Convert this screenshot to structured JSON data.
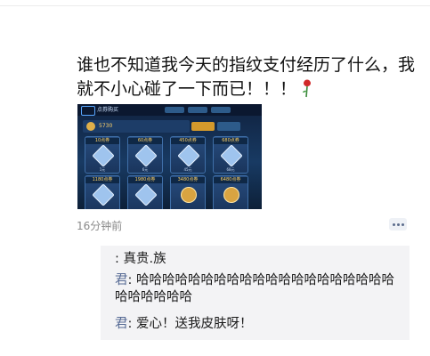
{
  "post": {
    "text": "谁也不知道我今天的指纹支付经历了什么，我就不小心碰了一下而已！！！",
    "emoji_icon": "wilted-rose-icon"
  },
  "screenshot": {
    "title": "点券购买",
    "points": "5730",
    "items": [
      {
        "price": "10点券",
        "note": "1元"
      },
      {
        "price": "60点券",
        "note": "6元"
      },
      {
        "price": "450点券",
        "note": "45元"
      },
      {
        "price": "680点券",
        "note": "68元"
      },
      {
        "price": "1180点券",
        "note": ""
      },
      {
        "price": "1980点券",
        "note": ""
      },
      {
        "price": "3480点券",
        "note": ""
      },
      {
        "price": "6480点券",
        "note": ""
      }
    ]
  },
  "meta": {
    "time": "16分钟前",
    "more_icon": "more-dots-icon"
  },
  "comments": [
    {
      "name": "",
      "sep": ": ",
      "text": "真贵.族"
    },
    {
      "name": "君",
      "sep": ": ",
      "text": "哈哈哈哈哈哈哈哈哈哈哈哈哈哈哈哈哈哈哈哈哈哈哈哈哈哈"
    },
    {
      "name": "君",
      "sep": ": ",
      "text": "爱心！送我皮肤呀！"
    }
  ]
}
